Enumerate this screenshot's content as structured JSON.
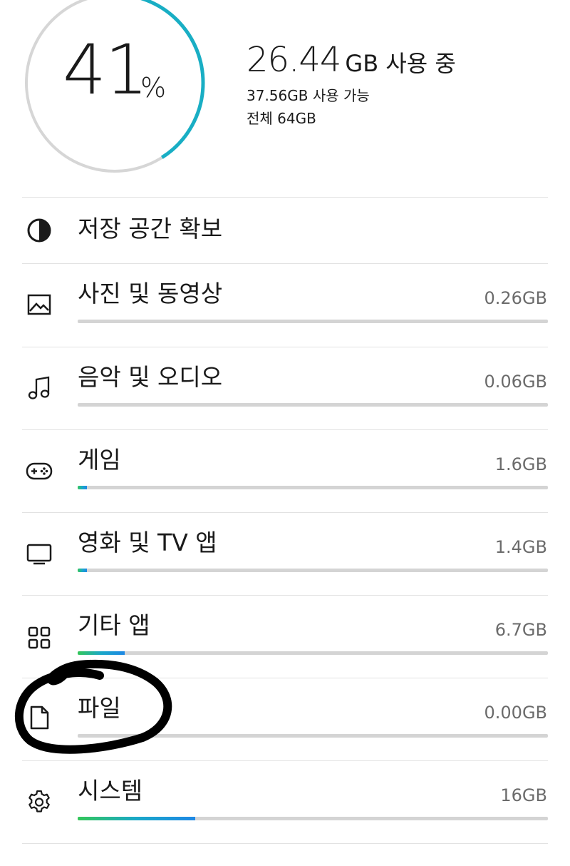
{
  "storage": {
    "percent": "41",
    "percent_unit": "%",
    "percent_fraction": 0.41,
    "used_value": "26.44",
    "used_unit": "GB 사용 중",
    "available": "37.56GB 사용 가능",
    "total": "전체 64GB",
    "gauge_color": "#19aec4",
    "track_color": "#d6d6d6"
  },
  "free_up": {
    "label": "저장 공간 확보",
    "icon": "half-circle-icon"
  },
  "categories": [
    {
      "label": "사진 및 동영상",
      "size": "0.26GB",
      "fill": 0.0,
      "icon": "image-icon"
    },
    {
      "label": "음악 및 오디오",
      "size": "0.06GB",
      "fill": 0.0,
      "icon": "music-note-icon"
    },
    {
      "label": "게임",
      "size": "1.6GB",
      "fill": 0.02,
      "icon": "gamepad-icon"
    },
    {
      "label": "영화 및 TV 앱",
      "size": "1.4GB",
      "fill": 0.02,
      "icon": "tv-icon"
    },
    {
      "label": "기타 앱",
      "size": "6.7GB",
      "fill": 0.1,
      "icon": "apps-grid-icon"
    },
    {
      "label": "파일",
      "size": "0.00GB",
      "fill": 0.0,
      "icon": "file-icon"
    },
    {
      "label": "시스템",
      "size": "16GB",
      "fill": 0.25,
      "icon": "gear-icon"
    }
  ],
  "annotation": {
    "type": "hand-drawn-circle",
    "color": "#000000",
    "target": "파일"
  }
}
